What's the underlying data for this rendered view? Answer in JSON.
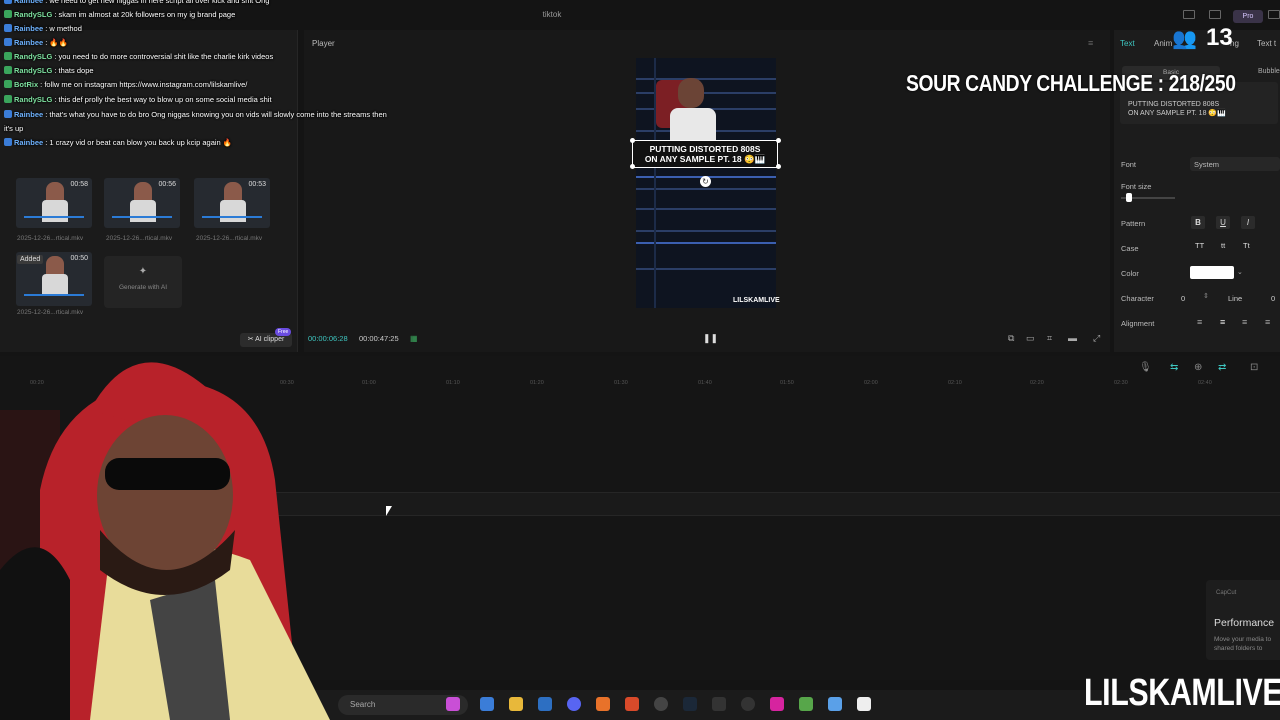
{
  "app": {
    "title": "tiktok",
    "pro_label": "Pro"
  },
  "media_panel": {
    "thumbs_row1": [
      {
        "duration": "00:58",
        "name": "2025-12-26...rtical.mkv"
      },
      {
        "duration": "00:56",
        "name": "2025-12-26...rtical.mkv"
      },
      {
        "duration": "00:53",
        "name": "2025-12-26...rtical.mkv"
      }
    ],
    "thumb_added": {
      "badge": "Added",
      "duration": "00:50",
      "name": "2025-12-26...rtical.mkv"
    },
    "generate_label": "Generate with AI",
    "ai_clipper_label": "AI clipper",
    "free_badge": "Free"
  },
  "chat": [
    {
      "user": "Rainbee",
      "msg": ": we need to get new niggas in here script all over kick and shit Ong",
      "badge": "blue"
    },
    {
      "user": "RandySLG",
      "msg": ": skam im almost at 20k followers on my ig brand page",
      "badge": "green"
    },
    {
      "user": "Rainbee",
      "msg": ": w method",
      "badge": "blue"
    },
    {
      "user": "Rainbee",
      "msg": ": 🔥🔥",
      "badge": "blue"
    },
    {
      "user": "RandySLG",
      "msg": ": you need to do more controversial shit like the charlie kirk videos",
      "badge": "green"
    },
    {
      "user": "RandySLG",
      "msg": ": thats dope",
      "badge": "green"
    },
    {
      "user": "BotRix",
      "msg": ": follw me on instagram https://www.instagram.com/lilskamlive/",
      "badge": "green"
    },
    {
      "user": "RandySLG",
      "msg": ": this def prolly the best way to blow up on some social media shit",
      "badge": "green"
    },
    {
      "user": "Rainbee",
      "msg": ": that's what you have to do bro Ong niggas knowing you on vids will slowly come into the streams then",
      "badge": "blue"
    },
    {
      "user": "",
      "msg": "it's up",
      "badge": ""
    },
    {
      "user": "Rainbee",
      "msg": ": 1 crazy vid or beat can blow you back up kcip again 🔥",
      "badge": "blue"
    }
  ],
  "player": {
    "label": "Player",
    "caption_line1": "PUTTING DISTORTED 808S",
    "caption_line2": "ON ANY SAMPLE PT. 18 😳🎹",
    "watermark": "LILSKAMLIVE",
    "time_current": "00:00:06:28",
    "time_total": "00:00:47:25"
  },
  "text_panel": {
    "tabs": [
      "Text",
      "Animation",
      "Tracking",
      "Text to"
    ],
    "tab_visible": [
      "Text",
      "Anim",
      "ng",
      "Text t"
    ],
    "basic": "Basic",
    "bubble": "Bubble",
    "preview_line1": "PUTTING DISTORTED 808S",
    "preview_line2": "ON ANY SAMPLE PT. 18 😳🎹",
    "font_label": "Font",
    "font_value": "System",
    "font_size_label": "Font size",
    "font_size_value": 0.15,
    "pattern_label": "Pattern",
    "pattern_buttons": [
      "B",
      "U",
      "I"
    ],
    "case_label": "Case",
    "case_buttons": [
      "TT",
      "tt",
      "Tt"
    ],
    "color_label": "Color",
    "color_value": "#ffffff",
    "character_label": "Character",
    "character_value": "0",
    "line_label": "Line",
    "line_value": "0",
    "alignment_label": "Alignment"
  },
  "timeline": {
    "ticks": [
      "00:20",
      "00:30",
      "00:50",
      "01:00",
      "01:10",
      "01:20",
      "01:30",
      "01:40",
      "01:50",
      "02:00",
      "02:10",
      "02:20",
      "02:30",
      "02:40"
    ]
  },
  "overlays": {
    "viewer_count": "13",
    "challenge": "SOUR CANDY CHALLENGE : 218/250",
    "streamer_name": "LILSKAMLIVE"
  },
  "toast": {
    "brand": "CapCut",
    "title": "Performance",
    "desc": "Move your media to shared folders to"
  },
  "taskbar": {
    "search_placeholder": "Search"
  }
}
